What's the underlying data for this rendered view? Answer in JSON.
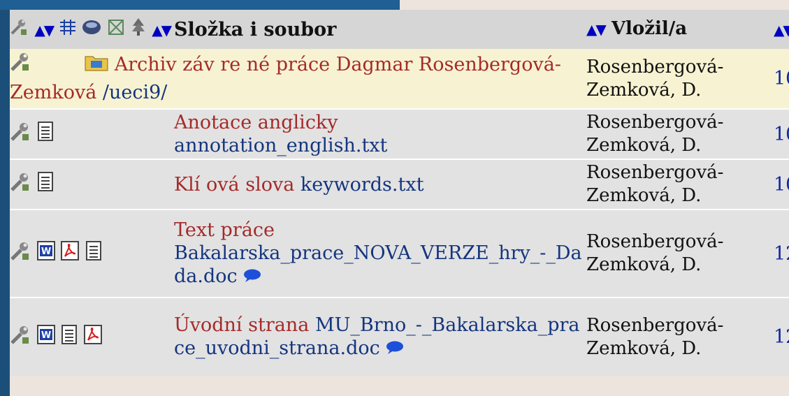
{
  "header": {
    "name_col": "Složka i soubor",
    "by_col": "Vložil/a"
  },
  "rows": [
    {
      "kind": "folder",
      "label": "Archiv záv re né práce Dagmar Rosenbergová-Zemková",
      "path": "/ueci9/",
      "by": "Rosenbergová-Zemková, D.",
      "date": "10."
    },
    {
      "kind": "file",
      "label": "Anotace anglicky",
      "file": "annotation_english.txt",
      "by": "Rosenbergová-Zemková, D.",
      "date": "10."
    },
    {
      "kind": "file",
      "label": "Klí ová slova",
      "file": "keywords.txt",
      "by": "Rosenbergová-Zemková, D.",
      "date": "10."
    },
    {
      "kind": "file",
      "label": "Text práce",
      "file": "Bakalarska_prace_NOVA_VERZE_hry_-_Dada.doc",
      "by": "Rosenbergová-Zemková, D.",
      "date": "12."
    },
    {
      "kind": "file",
      "label": "Úvodní strana",
      "file": "MU_Brno_-_Bakalarska_prace_uvodni_strana.doc",
      "by": "Rosenbergová-Zemková, D.",
      "date": "12."
    }
  ],
  "icons": [
    "settings-tool-icon",
    "sort-arrows-icon",
    "folder-icon",
    "text-file-icon",
    "word-doc-icon",
    "pdf-icon",
    "comment-bubble-icon"
  ],
  "colors": {
    "header_bg": "#d6d6d6",
    "folder_row_bg": "#f7f3d2",
    "file_row_bg": "#e2e2e2",
    "label_color": "#a52a2a",
    "link_color": "#14357e",
    "sort_arrow_color": "#0000c0",
    "left_strip": "#1b4f7a"
  }
}
